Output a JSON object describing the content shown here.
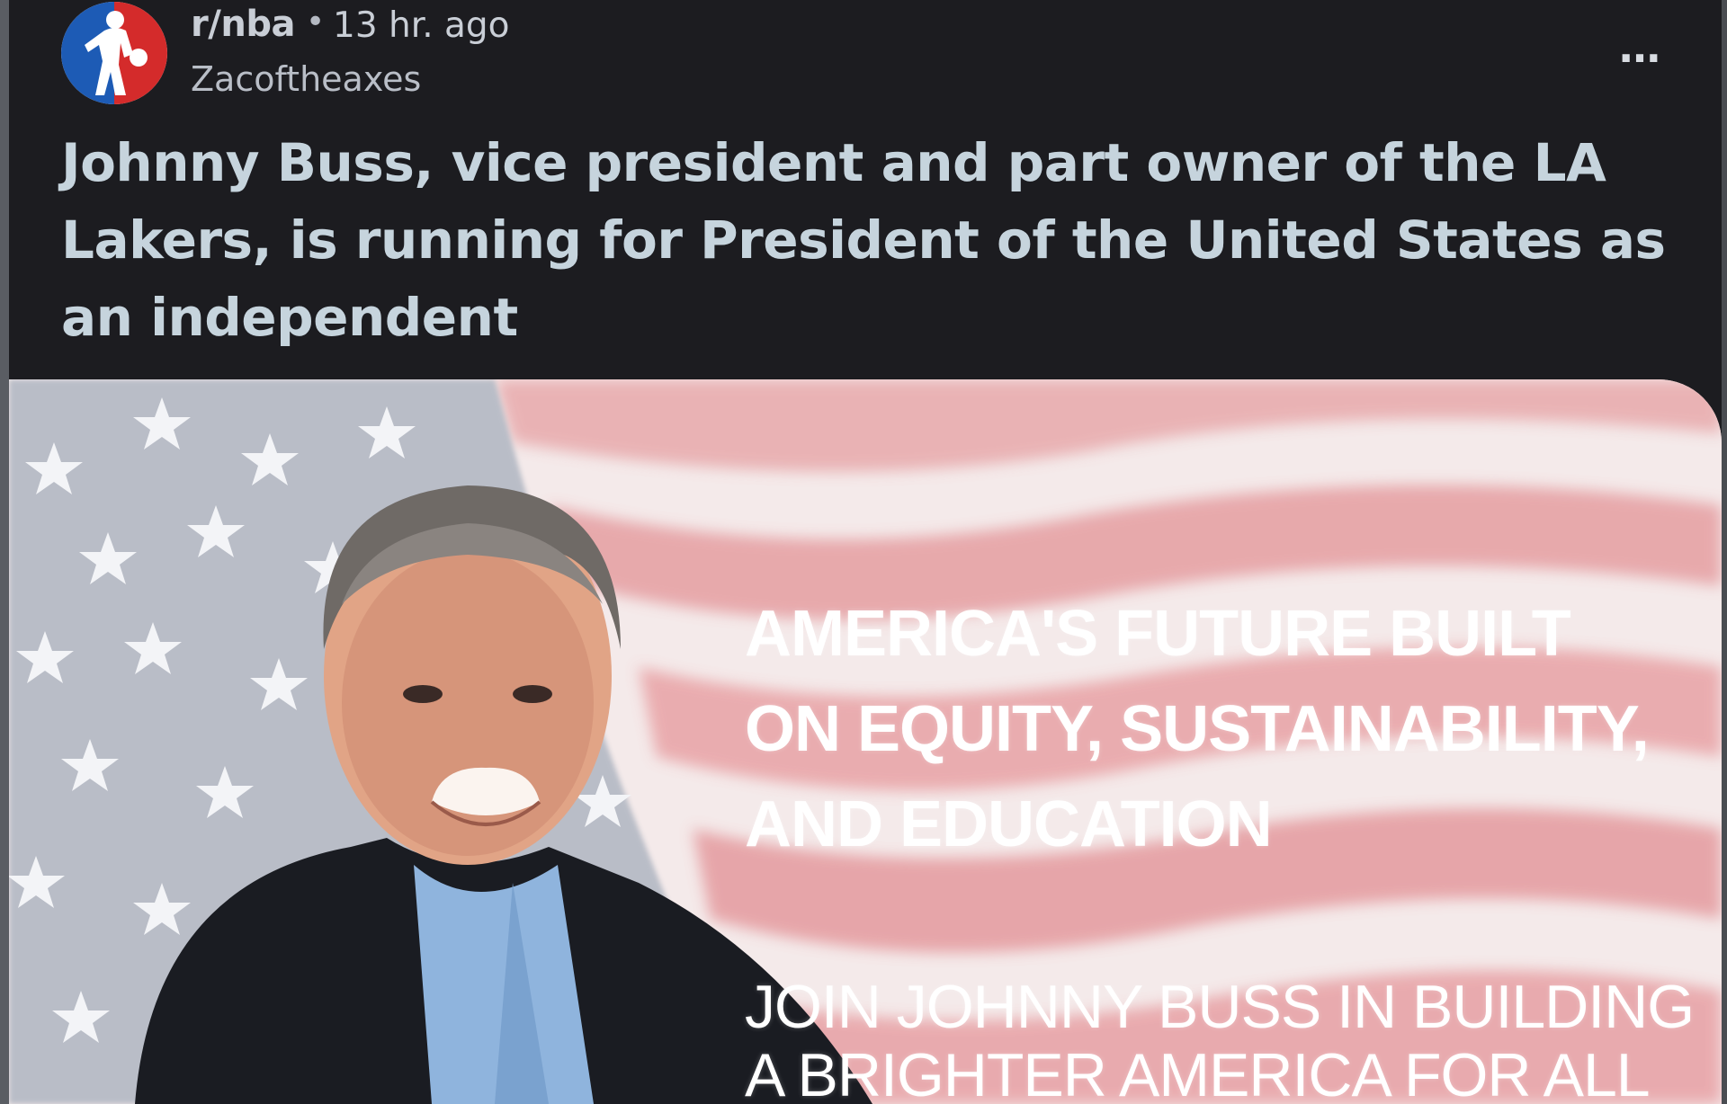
{
  "post": {
    "subreddit": "r/nba",
    "separator": "•",
    "time": "13 hr. ago",
    "author": "Zacoftheaxes",
    "more_icon": "…",
    "title": "Johnny Buss, vice president and part owner of the LA Lakers, is running for President of the United States as an independent"
  },
  "media": {
    "headline": "AMERICA'S FUTURE BUILT ON EQUITY, SUSTAINABILITY, AND EDUCATION",
    "cta": "JOIN JOHNNY BUSS IN BUILDING A BRIGHTER AMERICA FOR ALL"
  },
  "colors": {
    "background": "#1c1c20",
    "title": "#c6d4dd",
    "meta": "#c9ced6",
    "avatar_blue": "#1d5bb5",
    "avatar_red": "#d42b2b",
    "flag_red": "#e8a3a7",
    "flag_canton": "#b8bcc6"
  }
}
